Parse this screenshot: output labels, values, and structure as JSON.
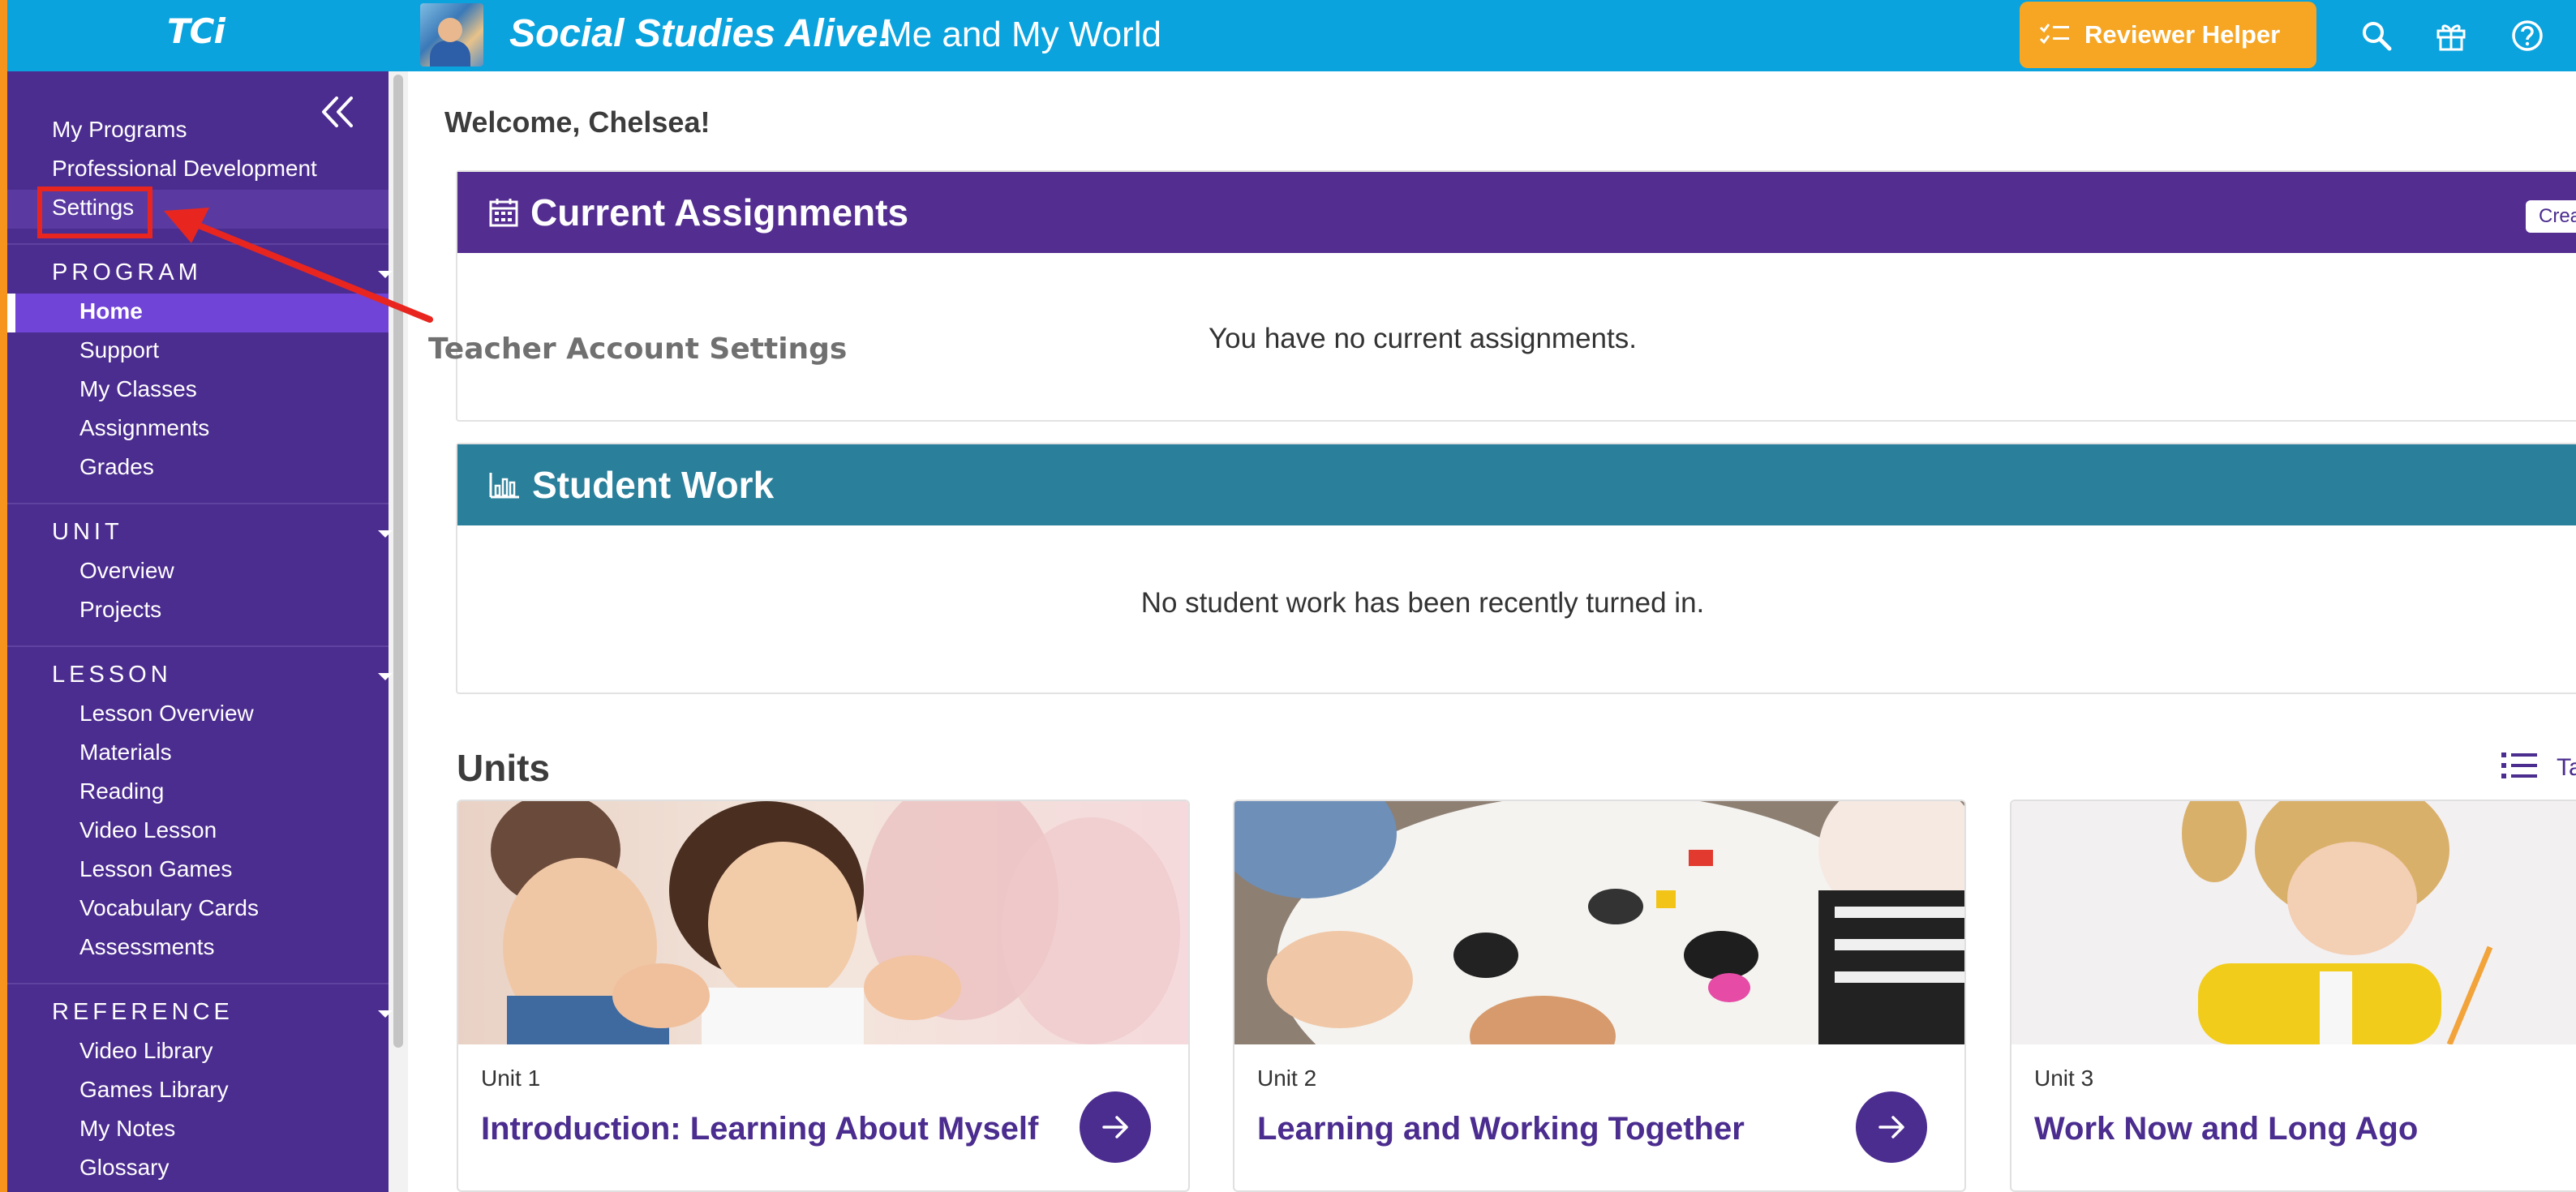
{
  "topbar": {
    "logo": "TCi",
    "program_title": "Social Studies Alive!",
    "program_subtitle": "Me and My World",
    "reviewer_helper_label": "Reviewer Helper"
  },
  "sidebar": {
    "top_links": [
      "My Programs",
      "Professional Development",
      "Settings"
    ],
    "sections": [
      {
        "title": "PROGRAM",
        "items": [
          "Home",
          "Support",
          "My Classes",
          "Assignments",
          "Grades"
        ]
      },
      {
        "title": "UNIT",
        "items": [
          "Overview",
          "Projects"
        ]
      },
      {
        "title": "LESSON",
        "items": [
          "Lesson Overview",
          "Materials",
          "Reading",
          "Video Lesson",
          "Lesson Games",
          "Vocabulary Cards",
          "Assessments"
        ]
      },
      {
        "title": "REFERENCE",
        "items": [
          "Video Library",
          "Games Library",
          "My Notes",
          "Glossary"
        ]
      }
    ],
    "active_item": "Home"
  },
  "main": {
    "welcome": "Welcome, Chelsea!",
    "current_assignments": {
      "title": "Current Assignments",
      "create_label": "Crea",
      "empty_message": "You have no current assignments."
    },
    "student_work": {
      "title": "Student Work",
      "empty_message": "No student work has been recently turned in."
    },
    "units_heading": "Units",
    "units_view_label": "Ta",
    "units": [
      {
        "number": "Unit 1",
        "title": "Introduction: Learning About Myself"
      },
      {
        "number": "Unit 2",
        "title": "Learning and Working Together"
      },
      {
        "number": "Unit 3",
        "title": "Work Now and Long Ago"
      }
    ]
  },
  "annotation": {
    "label": "Teacher Account Settings"
  },
  "colors": {
    "topbar": "#0aa3de",
    "sidebar": "#4b2c8f",
    "sidebar_active": "#6f44d6",
    "accent_orange": "#f6a623",
    "assignments_header": "#542d91",
    "student_work_header": "#2a7f9b",
    "annotation_red": "#e8261f"
  }
}
